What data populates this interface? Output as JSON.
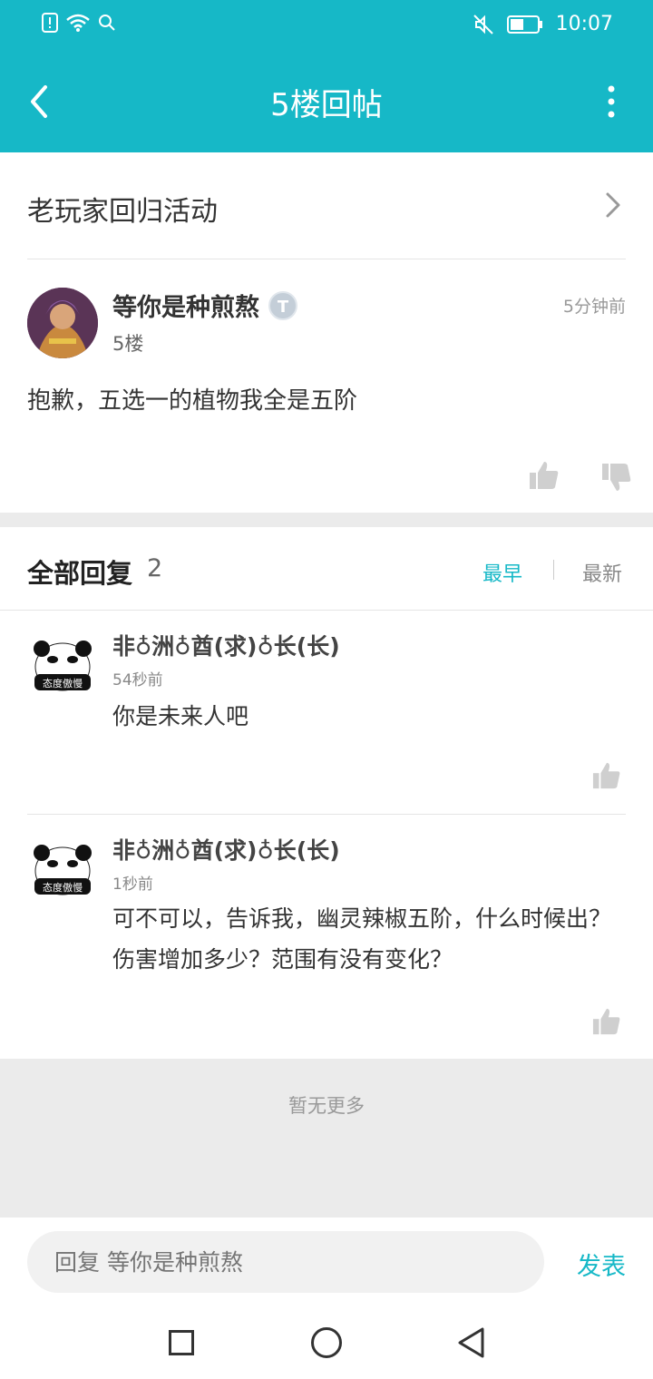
{
  "status_bar": {
    "time": "10:07"
  },
  "nav": {
    "title": "5楼回帖"
  },
  "activity": {
    "label": "老玩家回归活动"
  },
  "post": {
    "username": "等你是种煎熬",
    "badge": "T",
    "floor": "5楼",
    "time": "5分钟前",
    "content": "抱歉，五选一的植物我全是五阶"
  },
  "replies": {
    "title": "全部回复",
    "count": "2",
    "sort_earliest": "最早",
    "sort_latest": "最新",
    "items": [
      {
        "username": "非♁洲♁酋(求)♁长(长)",
        "time": "54秒前",
        "content": "你是未来人吧",
        "avatar_caption": "态度傲慢"
      },
      {
        "username": "非♁洲♁酋(求)♁长(长)",
        "time": "1秒前",
        "content": "可不可以，告诉我，幽灵辣椒五阶，什么时候出？伤害增加多少？范围有没有变化？",
        "avatar_caption": "态度傲慢"
      }
    ]
  },
  "no_more": "暂无更多",
  "composer": {
    "placeholder": "回复 等你是种煎熬",
    "send_label": "发表"
  },
  "colors": {
    "accent": "#16b8c7"
  }
}
